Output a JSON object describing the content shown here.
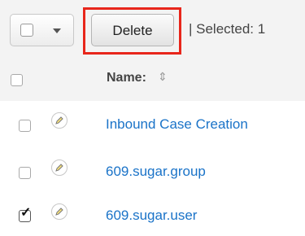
{
  "toolbar": {
    "delete_label": "Delete",
    "selected_text": "| Selected:  1"
  },
  "table": {
    "name_header": "Name:",
    "rows": [
      {
        "name": "Inbound Case Creation",
        "checked": false
      },
      {
        "name": "609.sugar.group",
        "checked": false
      },
      {
        "name": "609.sugar.user",
        "checked": true
      }
    ]
  },
  "icons": {
    "sort": "sort-arrows-icon",
    "edit": "pencil-icon",
    "caret": "chevron-down-icon"
  },
  "colors": {
    "link": "#1a73c8",
    "highlight": "#e8261b",
    "toolbar_bg": "#f3f3f3"
  }
}
